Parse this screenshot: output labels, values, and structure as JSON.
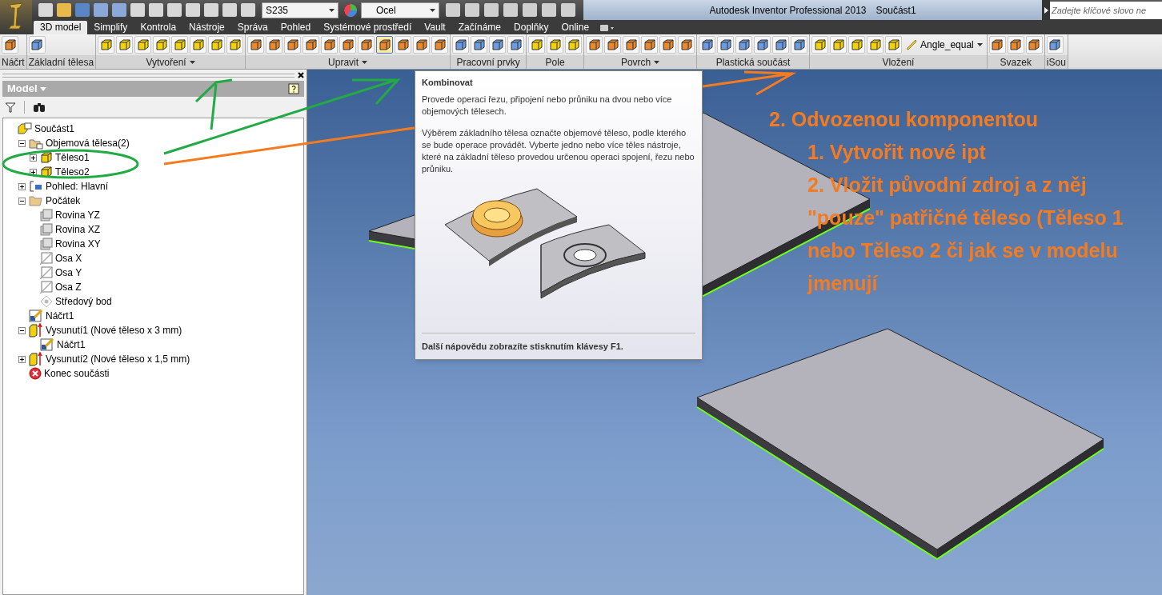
{
  "quick_access": {
    "material": "S235",
    "appearance": "Ocel"
  },
  "window": {
    "title": "Autodesk Inventor Professional 2013",
    "document": "Součást1"
  },
  "search": {
    "placeholder": "Zadejte klíčové slovo ne"
  },
  "menu_tabs": [
    {
      "label": "3D model",
      "selected": true
    },
    {
      "label": "Simplify",
      "selected": false
    },
    {
      "label": "Kontrola",
      "selected": false
    },
    {
      "label": "Nástroje",
      "selected": false
    },
    {
      "label": "Správa",
      "selected": false
    },
    {
      "label": "Pohled",
      "selected": false
    },
    {
      "label": "Systémové prostředí",
      "selected": false
    },
    {
      "label": "Vault",
      "selected": false
    },
    {
      "label": "Začínáme",
      "selected": false
    },
    {
      "label": "Doplňky",
      "selected": false
    },
    {
      "label": "Online",
      "selected": false
    }
  ],
  "ribbon_groups": [
    {
      "label": "Náčrt",
      "menu": false,
      "tools": [
        {
          "selected": false
        }
      ]
    },
    {
      "label": "Základní tělesa",
      "menu": false,
      "tools": [
        {
          "selected": false
        }
      ]
    },
    {
      "label": "Vytvoření",
      "menu": true,
      "tools": [
        {
          "selected": false
        },
        {
          "selected": false
        },
        {
          "selected": false
        },
        {
          "selected": false
        },
        {
          "selected": false
        },
        {
          "selected": false
        },
        {
          "selected": false
        },
        {
          "selected": false
        }
      ]
    },
    {
      "label": "Upravit",
      "menu": true,
      "tools": [
        {
          "selected": false
        },
        {
          "selected": false
        },
        {
          "selected": false
        },
        {
          "selected": false
        },
        {
          "selected": false
        },
        {
          "selected": false
        },
        {
          "selected": false
        },
        {
          "selected": true
        },
        {
          "selected": false
        },
        {
          "selected": false
        },
        {
          "selected": false
        }
      ]
    },
    {
      "label": "Pracovní prvky",
      "menu": false,
      "tools": [
        {
          "selected": false
        },
        {
          "selected": false
        },
        {
          "selected": false
        },
        {
          "selected": false
        }
      ]
    },
    {
      "label": "Pole",
      "menu": false,
      "tools": [
        {
          "selected": false
        },
        {
          "selected": false
        },
        {
          "selected": false
        }
      ]
    },
    {
      "label": "Povrch",
      "menu": true,
      "tools": [
        {
          "selected": false
        },
        {
          "selected": false
        },
        {
          "selected": false
        },
        {
          "selected": false
        },
        {
          "selected": false
        },
        {
          "selected": false
        }
      ]
    },
    {
      "label": "Plastická součást",
      "menu": false,
      "tools": [
        {
          "selected": false
        },
        {
          "selected": false
        },
        {
          "selected": false
        },
        {
          "selected": false
        },
        {
          "selected": false
        },
        {
          "selected": false
        }
      ]
    },
    {
      "label": "Vložení",
      "menu": false,
      "tools": [
        {
          "selected": false
        },
        {
          "selected": false
        },
        {
          "selected": false
        },
        {
          "selected": false
        },
        {
          "selected": false
        }
      ],
      "dropdown": "Angle_equal"
    },
    {
      "label": "Svazek",
      "menu": false,
      "tools": [
        {
          "selected": false
        },
        {
          "selected": false
        },
        {
          "selected": false
        }
      ]
    },
    {
      "label": "iSou",
      "menu": false,
      "tools": [
        {
          "selected": false
        }
      ]
    }
  ],
  "browser": {
    "title": "Model",
    "tree": [
      {
        "label": "Součást1",
        "kind": "part",
        "children": [
          {
            "label": "Objemová tělesa(2)",
            "kind": "bodies",
            "expanded": true,
            "children": [
              {
                "label": "Těleso1",
                "kind": "body",
                "expanded": false
              },
              {
                "label": "Těleso2",
                "kind": "body",
                "expanded": false
              }
            ]
          },
          {
            "label": "Pohled: Hlavní",
            "kind": "view",
            "expanded": false
          },
          {
            "label": "Počátek",
            "kind": "folder",
            "expanded": true,
            "children": [
              {
                "label": "Rovina YZ",
                "kind": "plane"
              },
              {
                "label": "Rovina XZ",
                "kind": "plane"
              },
              {
                "label": "Rovina XY",
                "kind": "plane"
              },
              {
                "label": "Osa X",
                "kind": "axis"
              },
              {
                "label": "Osa Y",
                "kind": "axis"
              },
              {
                "label": "Osa Z",
                "kind": "axis"
              },
              {
                "label": "Středový bod",
                "kind": "point"
              }
            ]
          },
          {
            "label": "Náčrt1",
            "kind": "sketch"
          },
          {
            "label": "Vysunutí1 (Nové těleso x 3 mm)",
            "kind": "extrusion",
            "expanded": true,
            "children": [
              {
                "label": "Náčrt1",
                "kind": "sketch"
              }
            ]
          },
          {
            "label": "Vysunutí2 (Nové těleso x 1,5 mm)",
            "kind": "extrusion",
            "expanded": false
          },
          {
            "label": "Konec součásti",
            "kind": "end"
          }
        ]
      }
    ]
  },
  "tooltip": {
    "title": "Kombinovat",
    "paragraphs": [
      "Provede operaci řezu, připojení nebo průniku na dvou nebo více objemových tělesech.",
      "Výběrem základního tělesa označte objemové těleso, podle kterého se bude operace provádět. Vyberte jedno nebo více těles nástroje, které na základní těleso provedou určenou operaci spojení, řezu nebo průniku."
    ],
    "footer": "Další nápovědu zobrazíte stisknutím klávesy F1."
  },
  "annotation": {
    "heading": "2. Odvozenou komponentou",
    "steps": [
      "1. Vytvořit nové ipt",
      "2. Vložit původní zdroj a z něj \"pouze\" patřičné těleso  (Těleso 1 nebo Těleso 2 či jak se v modelu jmenují"
    ]
  }
}
